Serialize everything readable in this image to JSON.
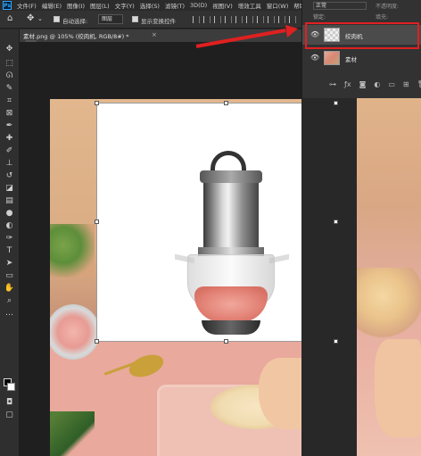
{
  "app": {
    "logo_text": "Ps"
  },
  "menu": {
    "items": [
      "文件(F)",
      "编辑(E)",
      "图像(I)",
      "图层(L)",
      "文字(Y)",
      "选择(S)",
      "滤镜(T)",
      "3D(D)",
      "视图(V)",
      "增效工具",
      "窗口(W)",
      "帮助(H)"
    ]
  },
  "options_bar": {
    "auto_select_label": "自动选择:",
    "auto_select_value": "图层",
    "show_transform_label": "显示变换控件"
  },
  "document": {
    "tab_title": "素材.png @ 105% (绞肉机, RGB/8#) *",
    "close_glyph": "×"
  },
  "layers_panel": {
    "blend_mode": "正常",
    "opacity_label": "不透明度:",
    "lock_label": "锁定:",
    "fill_label": "填充:",
    "layers": [
      {
        "name": "绞肉机",
        "selected": true,
        "visible": true
      },
      {
        "name": "素材",
        "selected": false,
        "visible": true
      }
    ],
    "highlight_color": "#e02020"
  },
  "toolbar": {
    "tools": [
      "move-icon",
      "artboard-icon",
      "marquee-icon",
      "lasso-icon",
      "quick-select-icon",
      "crop-icon",
      "frame-icon",
      "eyedropper-icon",
      "healing-icon",
      "brush-icon",
      "stamp-icon",
      "history-brush-icon",
      "eraser-icon",
      "gradient-icon",
      "blur-icon",
      "dodge-icon",
      "pen-icon",
      "type-icon",
      "path-select-icon",
      "shape-icon",
      "hand-icon",
      "zoom-icon"
    ]
  },
  "colors": {
    "foreground": "#000000",
    "background": "#ffffff",
    "accent": "#31a8ff"
  }
}
